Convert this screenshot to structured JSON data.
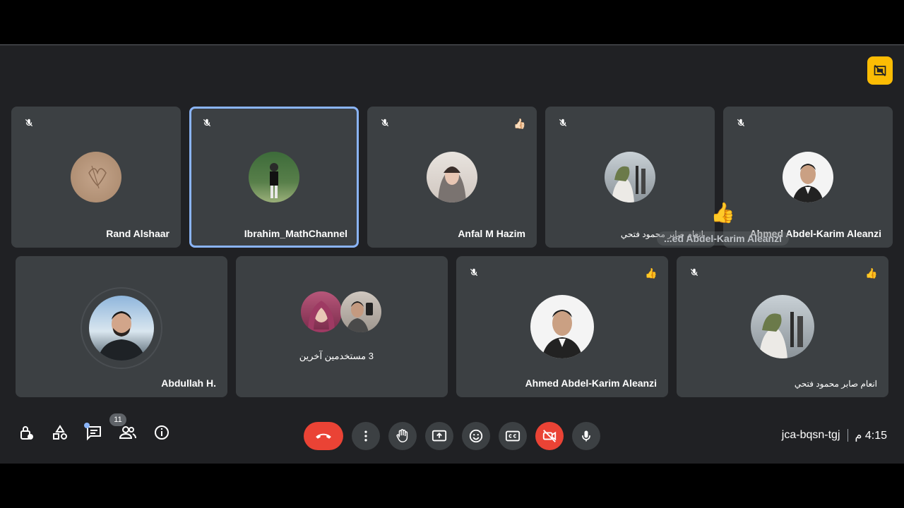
{
  "meeting": {
    "code": "jca-bqsn-tgj",
    "time": "4:15 م",
    "people_count": "11"
  },
  "colors": {
    "stage_bg": "#202124",
    "tile_bg": "#3c4043",
    "active_outline": "#8ab4f8",
    "danger": "#ea4335",
    "accent_yellow": "#fbbc04"
  },
  "tiles_row1": [
    {
      "name": "Rand Alshaar",
      "muted": true,
      "reaction": ""
    },
    {
      "name": "Ibrahim_MathChannel",
      "muted": true,
      "reaction": "",
      "active": true
    },
    {
      "name": "Anfal M Hazim",
      "muted": true,
      "reaction": "👍🏻"
    },
    {
      "name": "انعام صابر محمود فتحي",
      "muted": true,
      "reaction": ""
    },
    {
      "name": "Ahmed Abdel-Karim Aleanzi",
      "muted": true,
      "reaction": ""
    }
  ],
  "tiles_row2": [
    {
      "name": "Abdullah H.",
      "muted": false,
      "reaction": ""
    },
    {
      "name": "3 مستخدمين آخرين",
      "muted": false,
      "reaction": ""
    },
    {
      "name": "Ahmed Abdel-Karim Aleanzi",
      "muted": true,
      "reaction": "👍"
    },
    {
      "name": "انعام صابر محمود فتحي",
      "muted": true,
      "reaction": "👍"
    }
  ],
  "floating_reaction": {
    "emoji": "👍",
    "label": "...ed Abdel-Karim Aleanzi"
  },
  "icons": {
    "top_right": "no-video-frame-icon",
    "left_toolbar": [
      "host-controls-icon",
      "activities-icon",
      "chat-icon",
      "people-icon",
      "info-icon"
    ],
    "center_toolbar": [
      "end-call-icon",
      "more-options-icon",
      "raise-hand-icon",
      "present-screen-icon",
      "emoji-icon",
      "captions-icon",
      "camera-off-icon",
      "microphone-icon"
    ]
  }
}
